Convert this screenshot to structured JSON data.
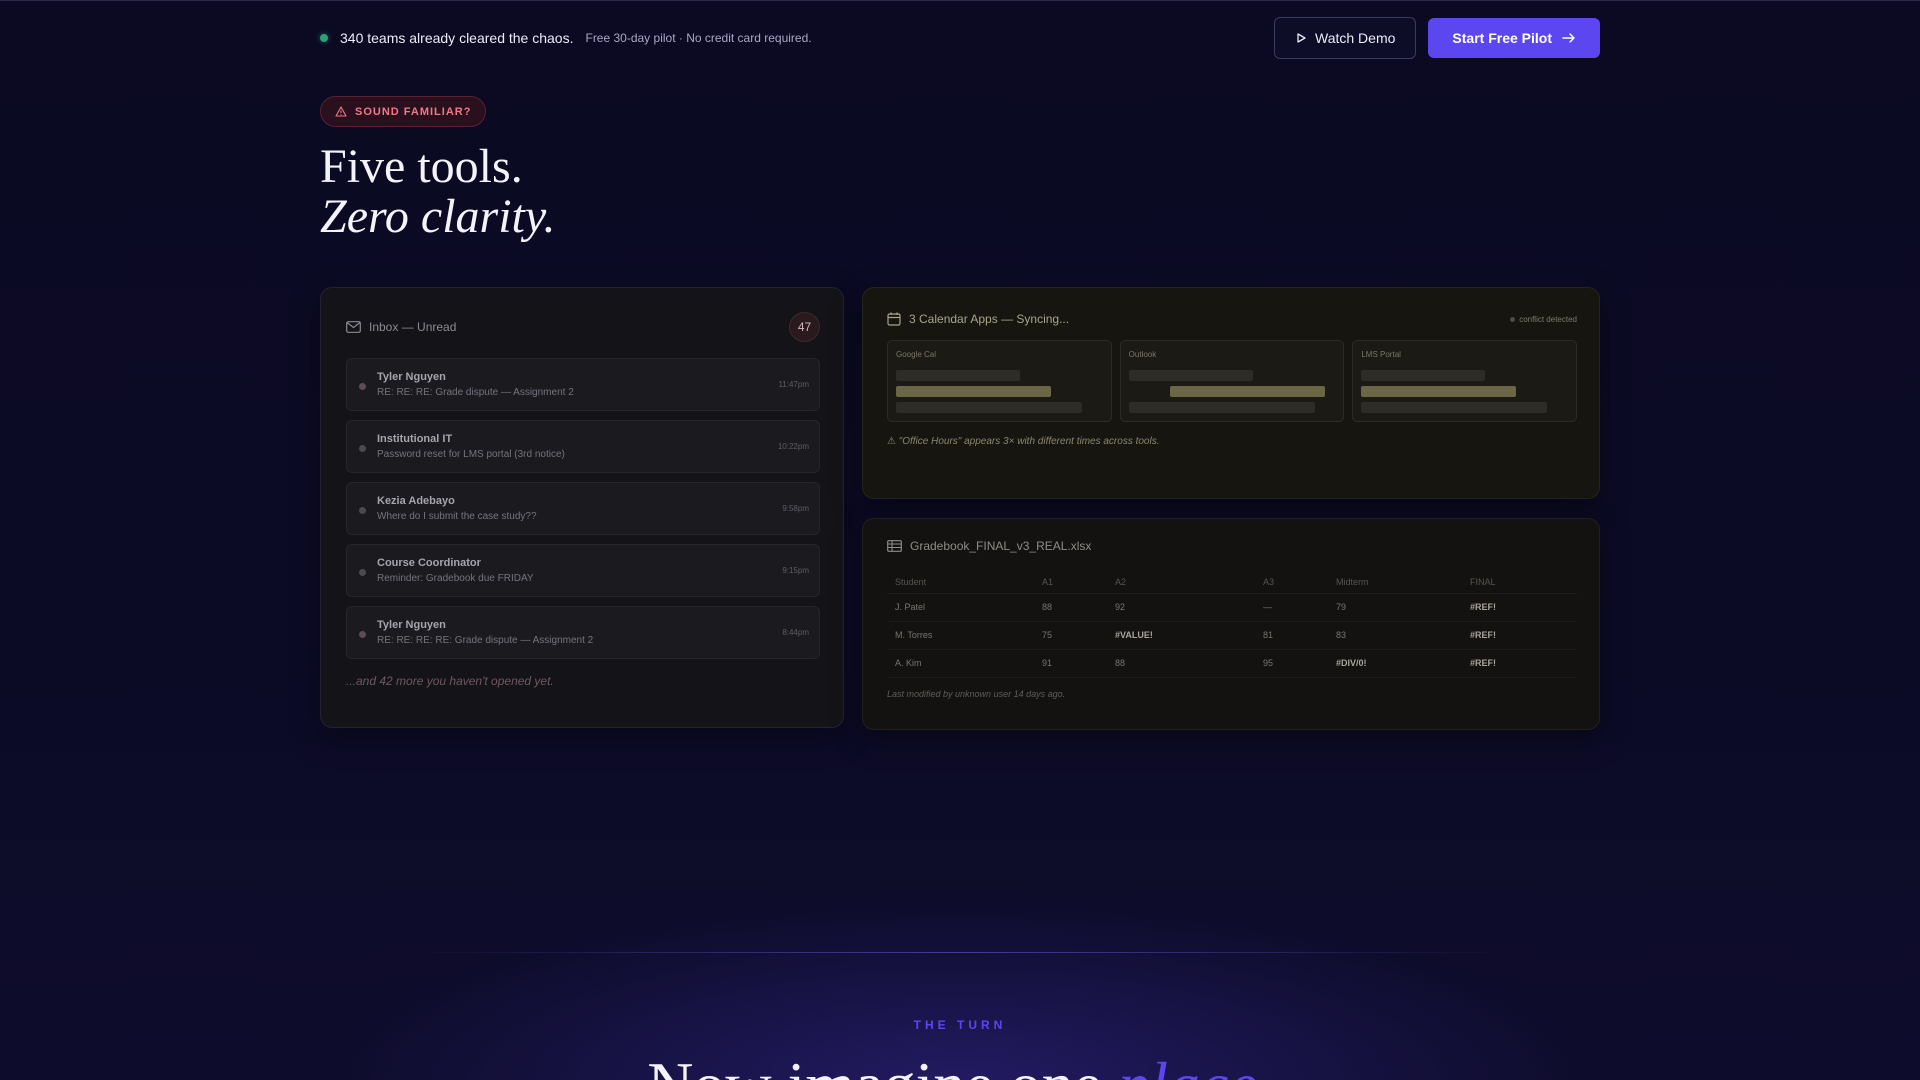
{
  "topbar": {
    "teams_text": "340 teams already cleared the chaos.",
    "pilot_note": "Free 30-day pilot · No credit card required.",
    "watch_demo": "Watch Demo",
    "start_pilot": "Start Free Pilot",
    "colors": {
      "accent": "#5b46f0",
      "live": "#2f9e7a"
    }
  },
  "hero": {
    "badge": "SOUND FAMILIAR?",
    "title_line1": "Five tools.",
    "title_line2": "Zero clarity."
  },
  "inbox": {
    "title": "Inbox — Unread",
    "count": "47",
    "messages": [
      {
        "from": "Tyler Nguyen",
        "subject": "RE: RE: RE: Grade dispute — Assignment 2",
        "time": "11:47pm"
      },
      {
        "from": "Institutional IT",
        "subject": "Password reset for LMS portal (3rd notice)",
        "time": "10:22pm"
      },
      {
        "from": "Kezia Adebayo",
        "subject": "Where do I submit the case study??",
        "time": "9:58pm"
      },
      {
        "from": "Course Coordinator",
        "subject": "Reminder: Gradebook due FRIDAY",
        "time": "9:15pm"
      },
      {
        "from": "Tyler Nguyen",
        "subject": "RE: RE: RE: RE: Grade dispute — Assignment 2",
        "time": "8:44pm"
      }
    ],
    "more": "...and 42 more you haven't opened yet."
  },
  "calendar": {
    "title": "3 Calendar Apps — Syncing...",
    "conflict": "conflict detected",
    "columns": [
      "Google Cal",
      "Outlook",
      "LMS Portal"
    ],
    "warning": "⚠ \"Office Hours\" appears 3× with different times across tools."
  },
  "gradebook": {
    "title": "Gradebook_FINAL_v3_REAL.xlsx",
    "headers": [
      "Student",
      "A1",
      "A2",
      "A3",
      "Midterm",
      "FINAL"
    ],
    "rows": [
      [
        "J. Patel",
        "88",
        "92",
        "—",
        "79",
        "#REF!"
      ],
      [
        "M. Torres",
        "75",
        "#VALUE!",
        "81",
        "83",
        "#REF!"
      ],
      [
        "A. Kim",
        "91",
        "88",
        "95",
        "#DIV/0!",
        "#REF!"
      ]
    ],
    "footer": "Last modified by unknown user 14 days ago."
  },
  "turn": {
    "label": "THE TURN",
    "title_start": "Now imagine one ",
    "title_accent": "place."
  }
}
